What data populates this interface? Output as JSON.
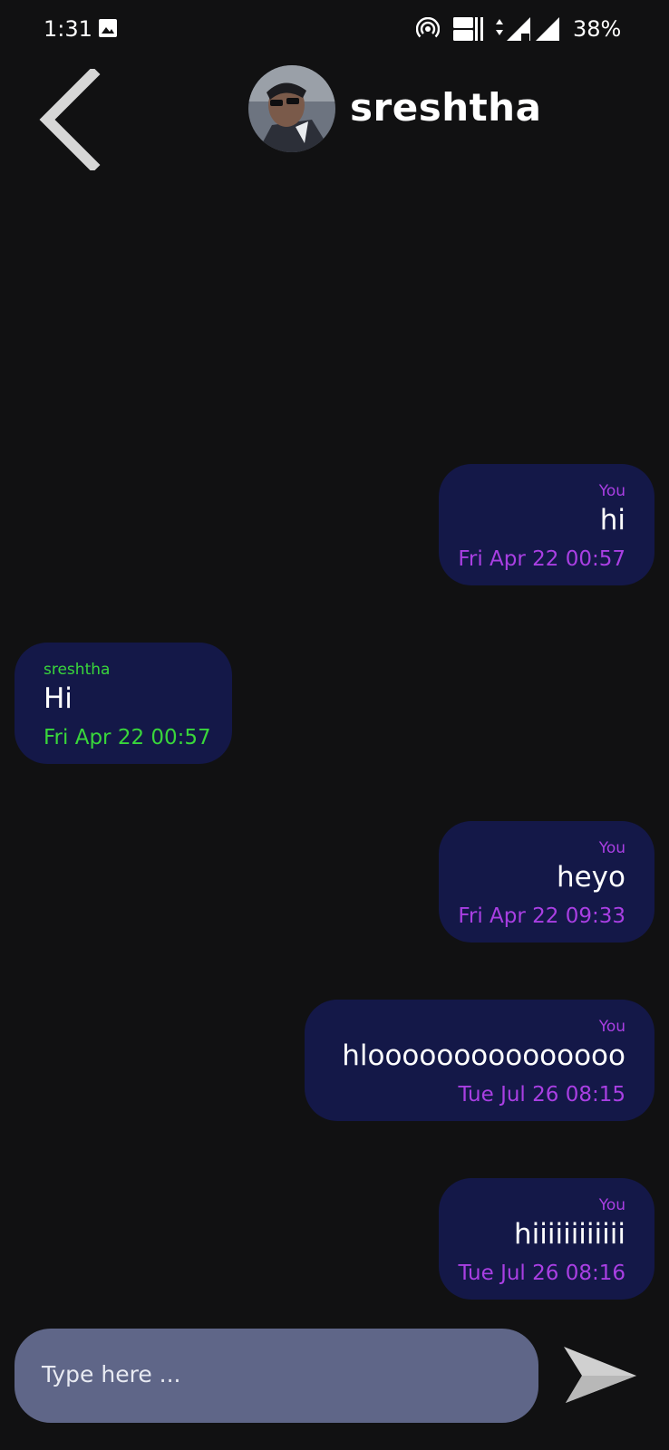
{
  "status_bar": {
    "time": "1:31",
    "battery": "38%",
    "icons": [
      "gallery-icon",
      "hotspot-icon",
      "volte-icon",
      "signal-icon"
    ]
  },
  "header": {
    "contact_name": "sreshtha",
    "back_icon": "chevron-left-icon"
  },
  "messages": [
    {
      "direction": "out",
      "sender": "You",
      "text": "hi",
      "time": "Fri Apr 22 00:57"
    },
    {
      "direction": "in",
      "sender": "sreshtha",
      "text": "Hi",
      "time": "Fri Apr 22 00:57"
    },
    {
      "direction": "out",
      "sender": "You",
      "text": "heyo",
      "time": "Fri Apr 22 09:33"
    },
    {
      "direction": "out",
      "sender": "You",
      "text": "hlooooooooooooooo",
      "time": "Tue Jul 26 08:15"
    },
    {
      "direction": "out",
      "sender": "You",
      "text": "hiiiiiiiiiiii",
      "time": "Tue Jul 26 08:16"
    }
  ],
  "composer": {
    "placeholder": "Type here ...",
    "send_icon": "send-icon"
  },
  "colors": {
    "background": "#111112",
    "bubble": "#141848",
    "outgoing_accent": "#a93fe3",
    "incoming_accent": "#39d63b",
    "composer": "#5f6688"
  }
}
